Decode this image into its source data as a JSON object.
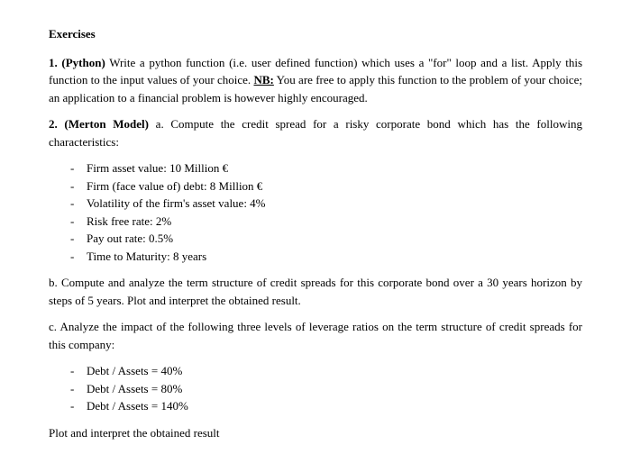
{
  "title": "Exercises",
  "ex1": {
    "label": "1. (Python)",
    "text_a": " Write a python function (i.e. user defined function) which uses a \"for\" loop and a list. Apply this function to the input values of your choice. ",
    "nb": "NB:",
    "text_b": " You are free to apply this function to the problem of your choice; an application to a financial problem is however highly encouraged."
  },
  "ex2": {
    "label": "2. (Merton Model)",
    "intro": " a. Compute the credit spread for a risky corporate bond which has the following characteristics:",
    "chars": [
      "Firm asset value:  10 Million €",
      "Firm (face value of) debt:  8 Million €",
      "Volatility of the firm's asset value: 4%",
      "Risk free rate: 2%",
      "Pay out rate: 0.5%",
      "Time to Maturity: 8 years"
    ],
    "b": "b. Compute and analyze the term structure of credit spreads for this corporate bond over a 30 years horizon by steps of 5 years. Plot and interpret the obtained result.",
    "c": "c. Analyze the impact of the following three levels of leverage ratios on the term structure of credit spreads for this company:",
    "ratios": [
      "Debt / Assets = 40%",
      "Debt / Assets = 80%",
      "Debt / Assets = 140%"
    ],
    "final": "Plot and interpret the obtained result"
  }
}
